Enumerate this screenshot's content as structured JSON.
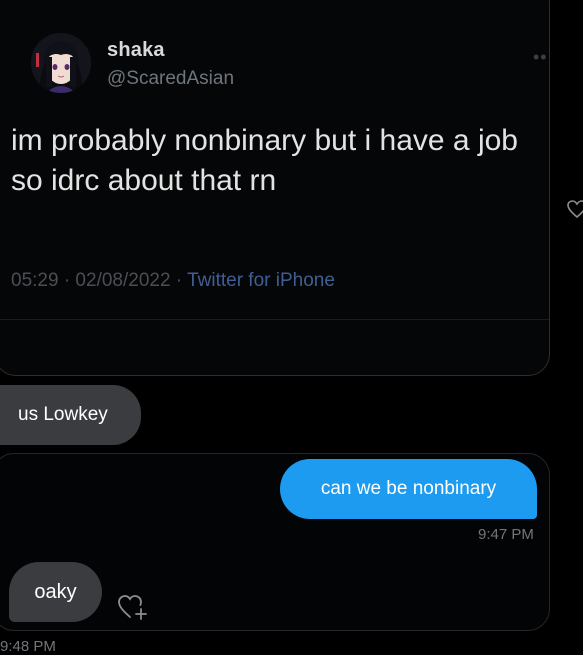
{
  "tweet": {
    "display_name": "shaka",
    "handle": "@ScaredAsian",
    "text": "im probably nonbinary but i have a job so idrc about that rn",
    "timestamp": "05:29 · 02/08/2022 · ",
    "source": "Twitter for iPhone",
    "more_icon": "more-dots-icon"
  },
  "conversation": {
    "shared_reply_label": "us Lowkey",
    "messages": [
      {
        "direction": "outgoing",
        "text": "can we be nonbinary",
        "time": "9:47 PM"
      },
      {
        "direction": "incoming",
        "text": "oaky",
        "time": "9:48 PM",
        "reaction_icon": "add-reaction-heart-icon"
      }
    ]
  },
  "colors": {
    "background": "#000000",
    "outgoing_bubble": "#1d9bf0",
    "incoming_bubble": "#3a3c3f",
    "secondary_text": "#71767b",
    "link_blue": "#3f5f94"
  }
}
